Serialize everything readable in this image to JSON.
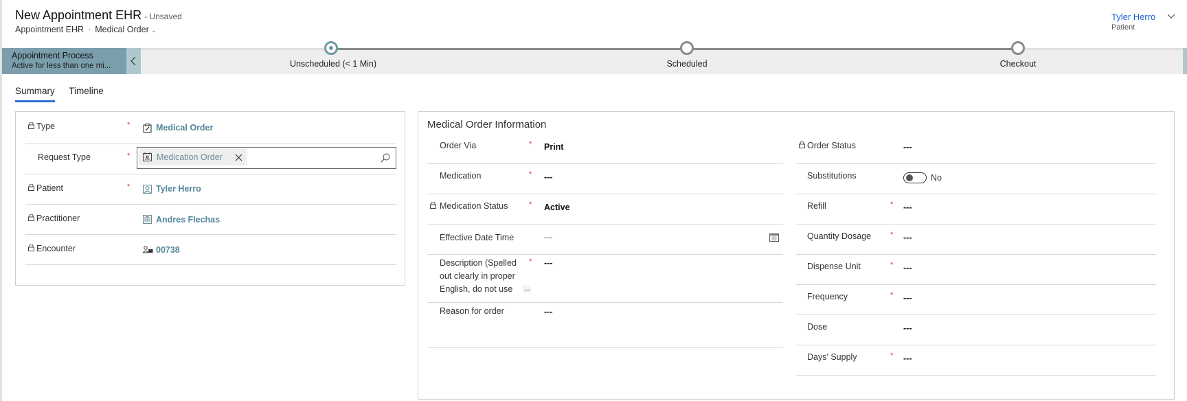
{
  "header": {
    "title": "New Appointment EHR",
    "save_state": "- Unsaved",
    "entity": "Appointment EHR",
    "separator": "·",
    "form_selector": "Medical Order",
    "owner_name": "Tyler Herro",
    "owner_role": "Patient"
  },
  "process": {
    "name": "Appointment Process",
    "status": "Active for less than one mi...",
    "stages": [
      {
        "label": "Unscheduled  (< 1 Min)",
        "active": true
      },
      {
        "label": "Scheduled",
        "active": false
      },
      {
        "label": "Checkout",
        "active": false
      }
    ]
  },
  "tabs": [
    {
      "label": "Summary",
      "active": true
    },
    {
      "label": "Timeline",
      "active": false
    }
  ],
  "summary": {
    "fields": [
      {
        "label": "Type",
        "locked": true,
        "required": true,
        "value": "Medical Order",
        "icon": "clipboard-icon"
      },
      {
        "label": "Request Type",
        "locked": false,
        "required": true,
        "value": "Medication Order",
        "icon": "medication-order-icon"
      },
      {
        "label": "Patient",
        "locked": true,
        "required": true,
        "value": "Tyler Herro",
        "icon": "patient-icon"
      },
      {
        "label": "Practitioner",
        "locked": true,
        "required": false,
        "value": "Andres Flechas",
        "icon": "practitioner-icon"
      },
      {
        "label": "Encounter",
        "locked": true,
        "required": false,
        "value": "00738",
        "icon": "encounter-icon"
      }
    ]
  },
  "medical_order": {
    "title": "Medical Order Information",
    "left_fields": [
      {
        "label": "Order Via",
        "locked": false,
        "required": true,
        "value": "Print"
      },
      {
        "label": "Medication",
        "locked": false,
        "required": true,
        "value": "---"
      },
      {
        "label": "Medication Status",
        "locked": true,
        "required": true,
        "value": "Active"
      },
      {
        "label": "Effective Date Time",
        "locked": false,
        "required": false,
        "value": "---"
      },
      {
        "label": "Description (Spelled out clearly in proper English, do not use",
        "locked": false,
        "required": true,
        "value": "---",
        "ellipsis": "..."
      },
      {
        "label": "Reason for order",
        "locked": false,
        "required": false,
        "value": "---"
      }
    ],
    "right_fields": [
      {
        "label": "Order Status",
        "locked": true,
        "required": false,
        "value": "---"
      },
      {
        "label": "Substitutions",
        "locked": false,
        "required": false,
        "value": "No",
        "toggle": true
      },
      {
        "label": "Refill",
        "locked": false,
        "required": true,
        "value": "---"
      },
      {
        "label": "Quantity Dosage",
        "locked": false,
        "required": true,
        "value": "---"
      },
      {
        "label": "Dispense Unit",
        "locked": false,
        "required": true,
        "value": "---"
      },
      {
        "label": "Frequency",
        "locked": false,
        "required": true,
        "value": "---"
      },
      {
        "label": "Dose",
        "locked": false,
        "required": false,
        "value": "---"
      },
      {
        "label": "Days' Supply",
        "locked": false,
        "required": true,
        "value": "---"
      }
    ]
  },
  "required_marker": "*",
  "colors": {
    "accent": "#2f6fd6",
    "process_active": "#7a9eac",
    "link": "#55879b",
    "required": "#d13438"
  }
}
